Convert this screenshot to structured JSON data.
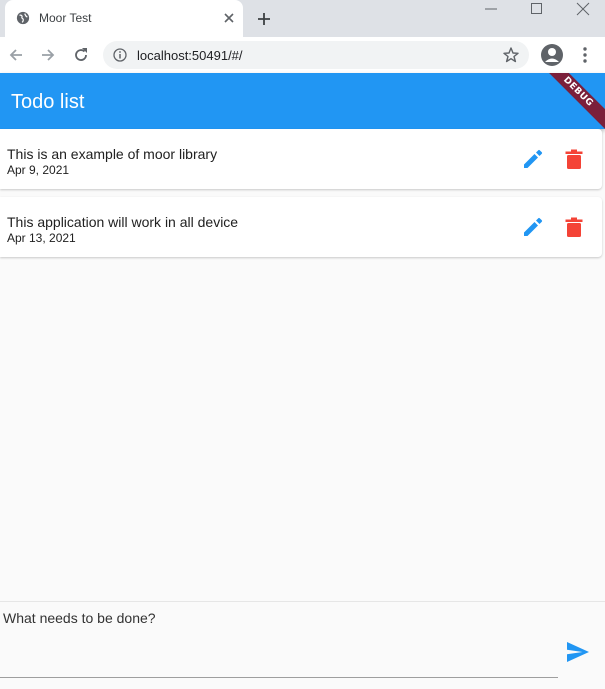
{
  "browser": {
    "tab_title": "Moor Test",
    "url": "localhost:50491/#/"
  },
  "app": {
    "title": "Todo list",
    "debug_label": "DEBUG",
    "accent_color": "#2196f3",
    "delete_color": "#f44336"
  },
  "todos": [
    {
      "title": "This is an example of moor library",
      "date": "Apr 9, 2021"
    },
    {
      "title": "This application will work in all device",
      "date": "Apr 13, 2021"
    }
  ],
  "composer": {
    "placeholder": "What needs to be done?",
    "value": ""
  }
}
